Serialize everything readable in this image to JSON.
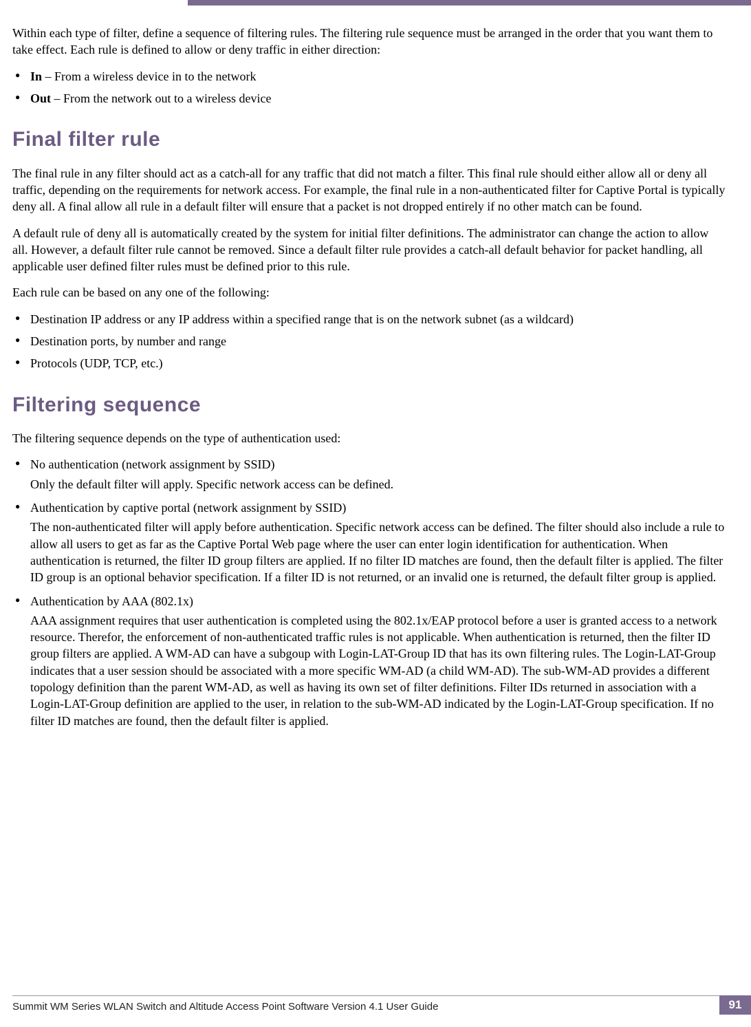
{
  "intro": {
    "p1": "Within each type of filter, define a sequence of filtering rules. The filtering rule sequence must be arranged in the order that you want them to take effect. Each rule is defined to allow or deny traffic in either direction:",
    "list": [
      {
        "bold": "In",
        "text": " – From a wireless device in to the network"
      },
      {
        "bold": "Out",
        "text": " – From the network out to a wireless device"
      }
    ]
  },
  "section1": {
    "heading": "Final filter rule",
    "p1": "The final rule in any filter should act as a catch-all for any traffic that did not match a filter. This final rule should either allow all or deny all traffic, depending on the requirements for network access. For example, the final rule in a non-authenticated filter for Captive Portal is typically deny all. A final allow all rule in a default filter will ensure that a packet is not dropped entirely if no other match can be found.",
    "p2": "A default rule of deny all is automatically created by the system for initial filter definitions. The administrator can change the action to allow all. However, a default filter rule cannot be removed. Since a default filter rule provides a catch-all default behavior for packet handling, all applicable user defined filter rules must be defined prior to this rule.",
    "p3": "Each rule can be based on any one of the following:",
    "list": [
      "Destination IP address or any IP address within a specified range that is on the network subnet (as a wildcard)",
      "Destination ports, by number and range",
      "Protocols (UDP, TCP, etc.)"
    ]
  },
  "section2": {
    "heading": "Filtering sequence",
    "p1": "The filtering sequence depends on the type of authentication used:",
    "items": [
      {
        "title": "No authentication (network assignment by SSID)",
        "body": "Only the default filter will apply. Specific network access can be defined."
      },
      {
        "title": "Authentication by captive portal (network assignment by SSID)",
        "body": "The non-authenticated filter will apply before authentication. Specific network access can be defined. The filter should also include a rule to allow all users to get as far as the Captive Portal Web page where the user can enter login identification for authentication. When authentication is returned, the filter ID group filters are applied. If no filter ID matches are found, then the default filter is applied. The filter ID group is an optional behavior specification. If a filter ID is not returned, or an invalid one is returned, the default filter group is applied."
      },
      {
        "title": "Authentication by AAA (802.1x)",
        "body": "AAA assignment requires that user authentication is completed using the 802.1x/EAP protocol before a user is granted access to a network resource. Therefor, the enforcement of non-authenticated traffic rules is not applicable. When authentication is returned, then the filter ID group filters are applied. A WM-AD can have a subgoup with Login-LAT-Group ID that has its own filtering rules. The Login-LAT-Group indicates that a user session should be associated with a more specific WM-AD (a child WM-AD). The sub-WM-AD provides a different topology definition than the parent WM-AD, as well as having its own set of filter definitions. Filter IDs returned in association with a Login-LAT-Group definition are applied to the user, in relation to the sub-WM-AD indicated by the Login-LAT-Group specification. If no filter ID matches are found, then the default filter is applied."
      }
    ]
  },
  "footer": {
    "text": "Summit WM Series WLAN Switch and Altitude Access Point Software Version 4.1 User Guide",
    "page": "91"
  }
}
